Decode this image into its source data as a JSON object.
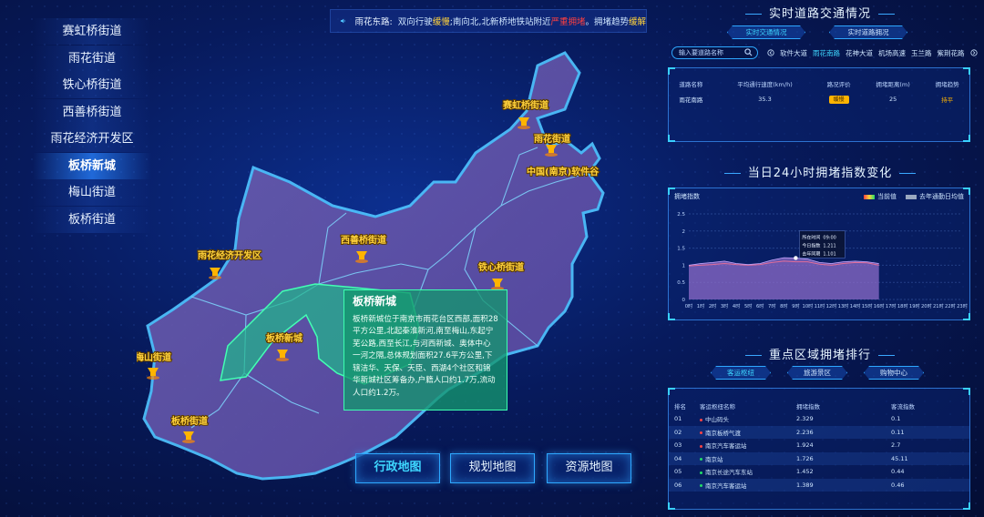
{
  "nav": {
    "items": [
      "赛虹桥街道",
      "雨花街道",
      "铁心桥街道",
      "西善桥街道",
      "雨花经济开发区",
      "板桥新城",
      "梅山街道",
      "板桥街道"
    ],
    "active_index": 5
  },
  "ticker": {
    "road": "雨花东路:",
    "seg1": "双向行驶",
    "seg1_status": "缓慢",
    "seg2": ";南向北,北新桥地铁站附近",
    "seg2_status": "严重拥堵",
    "seg3": "。拥堵趋势",
    "seg3_status": "缓解"
  },
  "map": {
    "labels": {
      "saihong": "赛虹桥街道",
      "yuhua": "雨花街道",
      "software": "中国(南京)软件谷",
      "xishan": "西善桥街道",
      "tiexin": "铁心桥街道",
      "econ": "雨花经济开发区",
      "banqiao_new": "板桥新城",
      "meishan": "梅山街道",
      "banqiao": "板桥街道"
    },
    "popup": {
      "title": "板桥新城",
      "body": "板桥新城位于南京市雨花台区西部,面积28平方公里,北起秦淮新河,南至梅山,东起宁芜公路,西至长江,与河西新城、奥体中心一河之隔,总体规划面积27.6平方公里,下辖洁华、天保、天臣、西湖4个社区和锦华新城社区筹备办,户籍人口约1.7万,流动人口约1.2万。"
    },
    "buttons": [
      "行政地图",
      "规划地图",
      "资源地图"
    ],
    "active_button": 0
  },
  "traffic": {
    "title": "实时道路交通情况",
    "tabs": [
      "实时交通情况",
      "实时道路拥况"
    ],
    "search_placeholder": "输入要道路名称",
    "roads": [
      "软件大道",
      "雨花南路",
      "花神大道",
      "机场高速",
      "玉兰路",
      "紫荆花路"
    ],
    "active_road": 1,
    "table": {
      "headers": [
        "道路名称",
        "平均通行速度(km/h)",
        "路况评价",
        "拥堵距离(m)",
        "拥堵趋势"
      ],
      "row": {
        "name": "雨花南路",
        "speed": "35.3",
        "eval": "缓慢",
        "distance": "25",
        "trend": "持平"
      }
    }
  },
  "congestion": {
    "title": "当日24小时拥堵指数变化",
    "ylabel": "拥堵指数",
    "legend_today": "当前值",
    "legend_avg": "去年通勤日均值",
    "tooltip": {
      "time_label": "所在时间",
      "time": "09:00",
      "today_label": "今日指数",
      "today": "1.211",
      "avg_label": "去年同期",
      "avg": "1.101"
    }
  },
  "chart_data": {
    "type": "area",
    "ylabel": "拥堵指数",
    "ylim": [
      0,
      2.5
    ],
    "yticks": [
      "0",
      "0.5",
      "1",
      "1.5",
      "2",
      "2.5"
    ],
    "categories": [
      "0时",
      "1时",
      "2时",
      "3时",
      "4时",
      "5时",
      "6时",
      "7时",
      "8时",
      "9时",
      "10时",
      "11时",
      "12时",
      "13时",
      "14时",
      "15时",
      "16时",
      "17时",
      "18时",
      "19时",
      "20时",
      "21时",
      "22时",
      "23时"
    ],
    "series": [
      {
        "name": "当前值",
        "values": [
          1.0,
          1.05,
          1.08,
          1.12,
          1.05,
          1.02,
          1.05,
          1.15,
          1.22,
          1.211,
          1.18,
          1.08,
          1.05,
          1.1,
          1.12,
          1.1,
          1.05
        ]
      },
      {
        "name": "去年通勤日均值",
        "values": [
          0.98,
          1.0,
          1.02,
          1.05,
          1.02,
          1.0,
          1.02,
          1.08,
          1.12,
          1.101,
          1.1,
          1.03,
          1.0,
          1.05,
          1.08,
          1.07,
          1.0
        ]
      }
    ],
    "colors": {
      "today": "#8c6bc8",
      "avg": "#e06e9a"
    }
  },
  "ranking": {
    "title": "重点区域拥堵排行",
    "tabs": [
      "客运枢纽",
      "旅游景区",
      "购物中心"
    ],
    "active_tab": 0,
    "headers": [
      "排名",
      "客运枢纽名称",
      "拥堵指数",
      "客流指数"
    ],
    "rows": [
      {
        "rank": "01",
        "name": "中山码头",
        "index": "2.329",
        "flow": "0.1",
        "dot": "#ff4444"
      },
      {
        "rank": "02",
        "name": "南京板桥气渡",
        "index": "2.236",
        "flow": "0.11",
        "dot": "#ff4444"
      },
      {
        "rank": "03",
        "name": "南京汽车客运站",
        "index": "1.924",
        "flow": "2.7",
        "dot": "#ff4444"
      },
      {
        "rank": "04",
        "name": "南京站",
        "index": "1.726",
        "flow": "45.11",
        "dot": "#22dd66"
      },
      {
        "rank": "05",
        "name": "南京长途汽车东站",
        "index": "1.452",
        "flow": "0.44",
        "dot": "#22dd66"
      },
      {
        "rank": "06",
        "name": "南京汽车客运站",
        "index": "1.389",
        "flow": "0.46",
        "dot": "#22dd66"
      }
    ]
  }
}
